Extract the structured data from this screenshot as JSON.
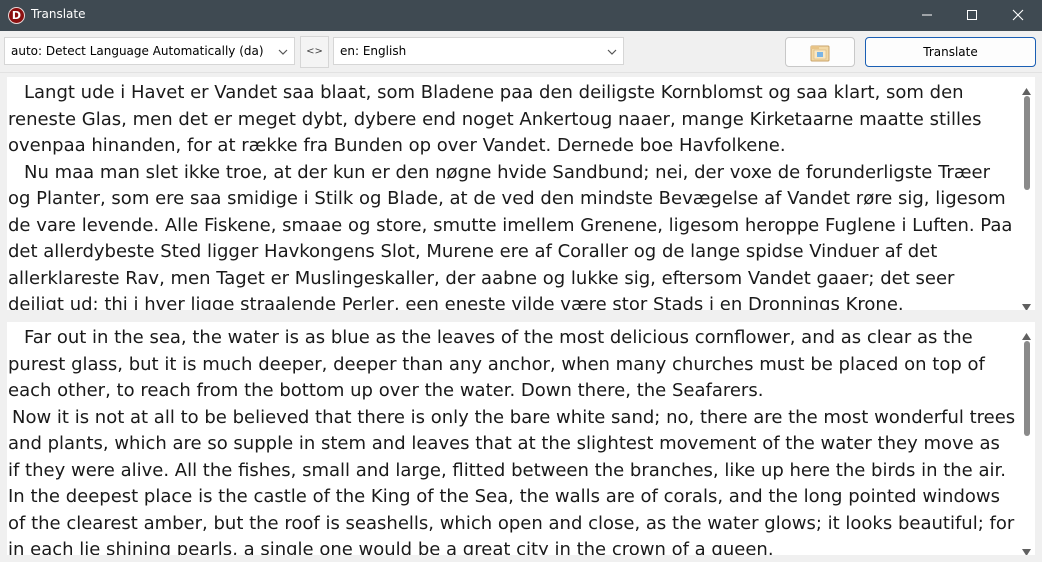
{
  "window": {
    "title": "Translate",
    "icon_letter": "D"
  },
  "toolbar": {
    "source_language": "auto: Detect Language Automatically (da)",
    "swap_label": "<>",
    "target_language": "en: English",
    "translate_label": "Translate"
  },
  "source_text": {
    "paragraphs": [
      "Langt ude i Havet er Vandet saa blaat, som Bladene paa den deiligste Kornblomst og saa klart, som den reneste Glas, men det er meget dybt, dybere end noget Ankertoug naaer, mange Kirketaarne maatte stilles ovenpaa hinanden, for at række fra Bunden op over Vandet. Dernede boe Havfolkene.",
      "Nu maa man slet ikke troe, at der kun er den nøgne hvide Sandbund; nei, der voxe de forunderligste Træer og Planter, som ere saa smidige i Stilk og Blade, at de ved den mindste Bevægelse af Vandet røre sig, ligesom de vare levende. Alle Fiskene, smaae og store, smutte imellem Grenene, ligesom heroppe Fuglene i Luften. Paa det allerdybeste Sted ligger Havkongens Slot, Murene ere af Coraller og de lange spidse Vinduer af det allerklareste Rav, men Taget er Muslingeskaller, der aabne og lukke sig, eftersom Vandet gaaer; det seer deiligt ud; thi i hver ligge straalende Perler, een eneste vilde være stor Stads i en Dronnings Krone."
    ]
  },
  "translated_text": {
    "paragraphs": [
      "Far out in the sea, the water is as blue as the leaves of the most delicious cornflower, and as clear as the purest glass, but it is much deeper, deeper than any anchor, when many churches must be placed on top of each other, to reach from the bottom up over the water. Down there, the Seafarers.",
      "Now it is not at all to be believed that there is only the bare white sand; no, there are the most wonderful trees and plants, which are so supple in stem and leaves that at the slightest movement of the water they move as if they were alive. All the fishes, small and large, flitted between the branches, like up here the birds in the air. In the deepest place is the castle of the King of the Sea, the walls are of corals, and the long pointed windows of the clearest amber, but the roof is seashells, which open and close, as the water glows; it looks beautiful; for in each lie shining pearls, a single one would be a great city in the crown of a queen."
    ]
  },
  "icons": {
    "app": "dictionary-app-icon",
    "minimize": "minimize-icon",
    "maximize": "maximize-icon",
    "close": "close-icon",
    "dropdown": "chevron-down-icon",
    "folder": "folder-icon",
    "scroll_up": "scroll-up-arrow-icon",
    "scroll_down": "scroll-down-arrow-icon"
  },
  "colors": {
    "titlebar": "#3f4a52",
    "app_icon": "#8b1010",
    "primary_button_border": "#1a5fb4",
    "window_background": "#f0f0f0"
  }
}
